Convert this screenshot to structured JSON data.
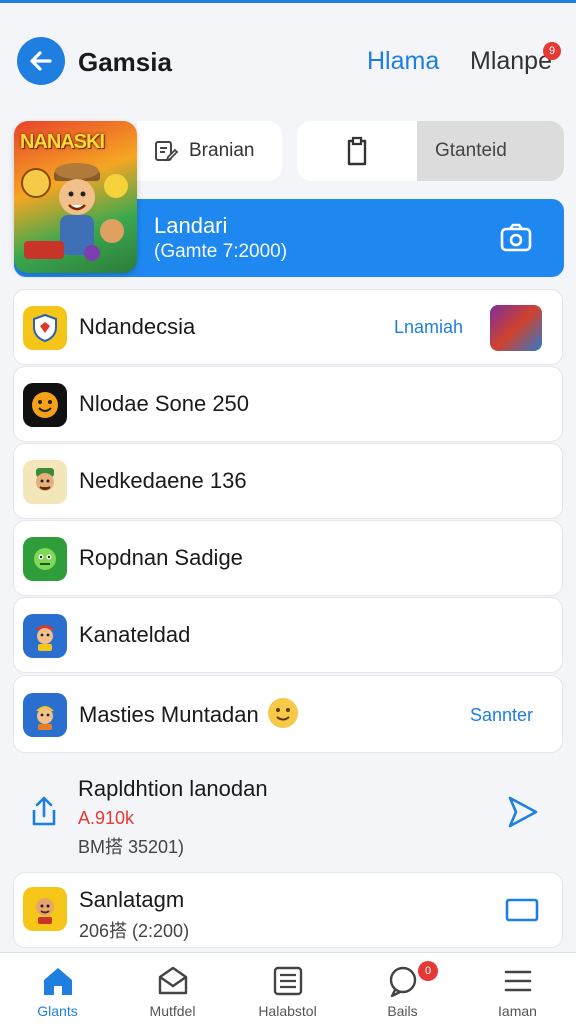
{
  "header": {
    "title": "Gamsia",
    "link1": "Hlama",
    "link2": "Mlanpe",
    "badge": "9"
  },
  "hero": {
    "game_title": "NANASKI",
    "chip1_label": "Branian",
    "chip2_label": "Gtanteid",
    "banner_title": "Landari",
    "banner_sub": "(Gamte 7:2000)"
  },
  "list": [
    {
      "name": "Ndandecsia",
      "action": "Lnamiah"
    },
    {
      "name": "Nlodae Sone  250",
      "action": ""
    },
    {
      "name": "Nedkedaene 136",
      "action": ""
    },
    {
      "name": "Ropdnan Sadige",
      "action": ""
    },
    {
      "name": "Kanateldad",
      "action": ""
    },
    {
      "name": "Masties Muntadan",
      "action": "Sannter"
    }
  ],
  "featured": {
    "title": "Rapldhtion lanodan",
    "sub_red": "A.910k",
    "sub": "BM搭 35201)"
  },
  "last_card": {
    "name": "Sanlatagm",
    "sub": "206搭 (2:200)"
  },
  "nav": [
    {
      "label": "Glants",
      "icon": "home-icon"
    },
    {
      "label": "Mutfdel",
      "icon": "mail-icon"
    },
    {
      "label": "Halabstol",
      "icon": "list-icon"
    },
    {
      "label": "Bails",
      "icon": "chat-icon",
      "badge": "0"
    },
    {
      "label": "Iaman",
      "icon": "menu-icon"
    }
  ],
  "colors": {
    "accent": "#1e7fe0",
    "banner": "#1e88f0",
    "badge": "#e53935"
  }
}
